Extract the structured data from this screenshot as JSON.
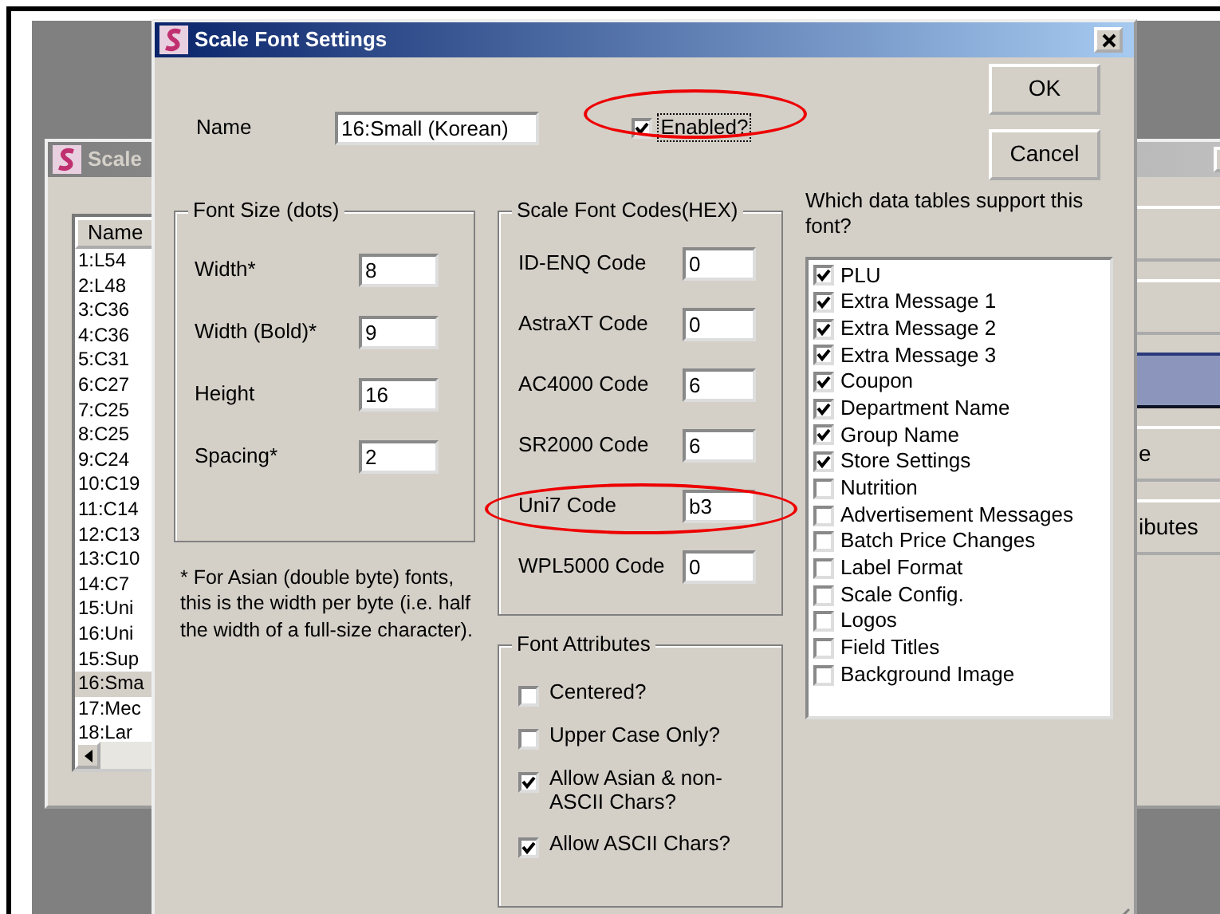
{
  "background_window": {
    "title": "Scale",
    "list_header": "Name",
    "list_items": [
      {
        "label": "1:L54",
        "selected": false
      },
      {
        "label": "2:L48",
        "selected": false
      },
      {
        "label": "3:C36",
        "selected": false
      },
      {
        "label": "4:C36",
        "selected": false
      },
      {
        "label": "5:C31",
        "selected": false
      },
      {
        "label": "6:C27",
        "selected": false
      },
      {
        "label": "7:C25",
        "selected": false
      },
      {
        "label": "8:C25",
        "selected": false
      },
      {
        "label": "9:C24",
        "selected": false
      },
      {
        "label": "10:C19",
        "selected": false
      },
      {
        "label": "11:C14",
        "selected": false
      },
      {
        "label": "12:C13",
        "selected": false
      },
      {
        "label": "13:C10",
        "selected": false
      },
      {
        "label": "14:C7",
        "selected": false
      },
      {
        "label": "15:Uni",
        "selected": false
      },
      {
        "label": "16:Uni",
        "selected": false
      },
      {
        "label": "15:Sup",
        "selected": false
      },
      {
        "label": "16:Sma",
        "selected": true
      },
      {
        "label": "17:Mec",
        "selected": false
      },
      {
        "label": "18:Lar",
        "selected": false
      }
    ],
    "buttons": [
      {
        "selected": false
      },
      {
        "selected": false
      },
      {
        "selected": true
      },
      {
        "label": "e",
        "selected": false
      },
      {
        "label": "ibutes",
        "selected": false
      }
    ]
  },
  "dialog": {
    "title": "Scale Font Settings",
    "name_label": "Name",
    "name_value": "16:Small (Korean)",
    "enabled": {
      "label": "Enabled?",
      "checked": true,
      "highlighted": true
    },
    "buttons": [
      {
        "label": "OK"
      },
      {
        "label": "Cancel"
      }
    ],
    "font_size": {
      "title": "Font Size (dots)",
      "fields": [
        {
          "label": "Width*",
          "value": "8"
        },
        {
          "label": "Width (Bold)*",
          "value": "9"
        },
        {
          "label": "Height",
          "value": "16"
        },
        {
          "label": "Spacing*",
          "value": "2"
        }
      ]
    },
    "note": "* For Asian (double byte) fonts, this is the width per byte (i.e. half the width of a full-size character).",
    "codes": {
      "title": "Scale Font Codes(HEX)",
      "fields": [
        {
          "label": "ID-ENQ Code",
          "value": "0",
          "highlighted": false
        },
        {
          "label": "AstraXT Code",
          "value": "0",
          "highlighted": false
        },
        {
          "label": "AC4000 Code",
          "value": "6",
          "highlighted": false
        },
        {
          "label": "SR2000 Code",
          "value": "6",
          "highlighted": false
        },
        {
          "label": "Uni7 Code",
          "value": "b3",
          "highlighted": true
        },
        {
          "label": "WPL5000 Code",
          "value": "0",
          "highlighted": false
        }
      ]
    },
    "attributes": {
      "title": "Font Attributes",
      "options": [
        {
          "label": "Centered?",
          "checked": false
        },
        {
          "label": "Upper Case Only?",
          "checked": false
        },
        {
          "label": "Allow Asian & non-ASCII Chars?",
          "checked": true
        },
        {
          "label": "Allow ASCII Chars?",
          "checked": true
        }
      ]
    },
    "tables": {
      "label": "Which data tables support this font?",
      "items": [
        {
          "label": "PLU",
          "checked": true
        },
        {
          "label": "Extra Message 1",
          "checked": true
        },
        {
          "label": "Extra Message 2",
          "checked": true
        },
        {
          "label": "Extra Message 3",
          "checked": true
        },
        {
          "label": "Coupon",
          "checked": true
        },
        {
          "label": "Department Name",
          "checked": true
        },
        {
          "label": "Group Name",
          "checked": true
        },
        {
          "label": "Store Settings",
          "checked": true
        },
        {
          "label": "Nutrition",
          "checked": false
        },
        {
          "label": "Advertisement Messages",
          "checked": false
        },
        {
          "label": "Batch Price Changes",
          "checked": false
        },
        {
          "label": "Label Format",
          "checked": false
        },
        {
          "label": "Scale Config.",
          "checked": false
        },
        {
          "label": "Logos",
          "checked": false
        },
        {
          "label": "Field Titles",
          "checked": false
        },
        {
          "label": "Background Image",
          "checked": false
        }
      ]
    }
  }
}
